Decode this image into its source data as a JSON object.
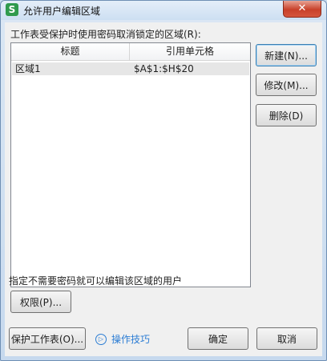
{
  "window": {
    "title": "允许用户编辑区域",
    "app_icon_glyph": "S",
    "close_glyph": "✕"
  },
  "dialog": {
    "ranges_label": "工作表受保护时使用密码取消锁定的区域(R):",
    "list": {
      "columns": [
        "标题",
        "引用单元格"
      ],
      "rows": [
        {
          "title": "区域1",
          "ref": "$A$1:$H$20"
        }
      ]
    },
    "buttons": {
      "new": "新建(N)...",
      "modify": "修改(M)...",
      "delete": "删除(D)",
      "permissions": "权限(P)...",
      "protect_sheet": "保护工作表(O)...",
      "ok": "确定",
      "cancel": "取消"
    },
    "no_password_label": "指定不需要密码就可以编辑该区域的用户",
    "tips_link": "操作技巧",
    "tips_icon_glyph": "▷"
  },
  "colors": {
    "accent": "#2c7dd4",
    "close": "#c8412a",
    "app_icon": "#2f9a4d"
  }
}
